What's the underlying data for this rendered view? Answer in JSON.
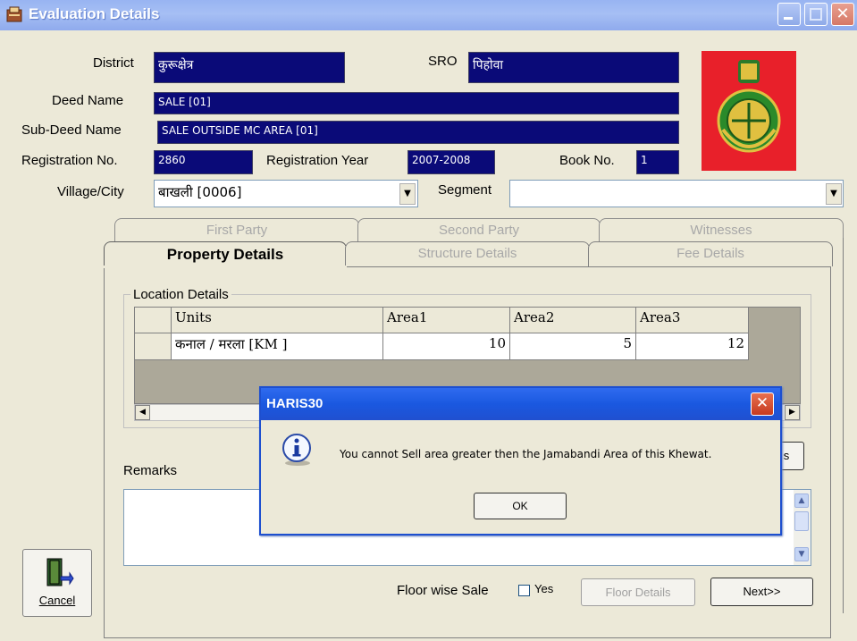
{
  "window": {
    "title": "Evaluation Details"
  },
  "form": {
    "district_label": "District",
    "district_value": "कुरूक्षेत्र",
    "sro_label": "SRO",
    "sro_value": "पिहोवा",
    "deed_name_label": "Deed Name",
    "deed_name_value": "SALE [01]",
    "sub_deed_label": "Sub-Deed Name",
    "sub_deed_value": "SALE OUTSIDE MC AREA [01]",
    "reg_no_label": "Registration No.",
    "reg_no_value": "2860",
    "reg_year_label": "Registration Year",
    "reg_year_value": "2007-2008",
    "book_no_label": "Book No.",
    "book_no_value": "1",
    "village_label": "Village/City",
    "village_value": "बाखली [0006]",
    "segment_label": "Segment",
    "segment_value": ""
  },
  "tabs": {
    "back": [
      "First Party",
      "Second Party",
      "Witnesses"
    ],
    "front": [
      "Property Details",
      "Structure Details",
      "Fee Details"
    ],
    "active": "Property Details"
  },
  "location": {
    "group_label": "Location Details",
    "headers": [
      "Units",
      "Area1",
      "Area2",
      "Area3"
    ],
    "row": [
      "कनाल / मरला [KM ]",
      "10",
      "5",
      "12"
    ]
  },
  "remarks_label": "Remarks",
  "floor_wise_label": "Floor wise Sale",
  "yes_label": "Yes",
  "floor_details_label": "Floor Details",
  "next_label": "Next>>",
  "cancel_label": "Cancel",
  "partial_button_label": "s",
  "dialog": {
    "title": "HARIS30",
    "message": "You cannot Sell area greater then the Jamabandi Area of this Khewat.",
    "ok_label": "OK"
  },
  "colors": {
    "field_bg": "#0a0a78",
    "titlebar": "#98b4f2",
    "dialog_titlebar": "#1a58e0",
    "emblem_bg": "#e8202a"
  }
}
